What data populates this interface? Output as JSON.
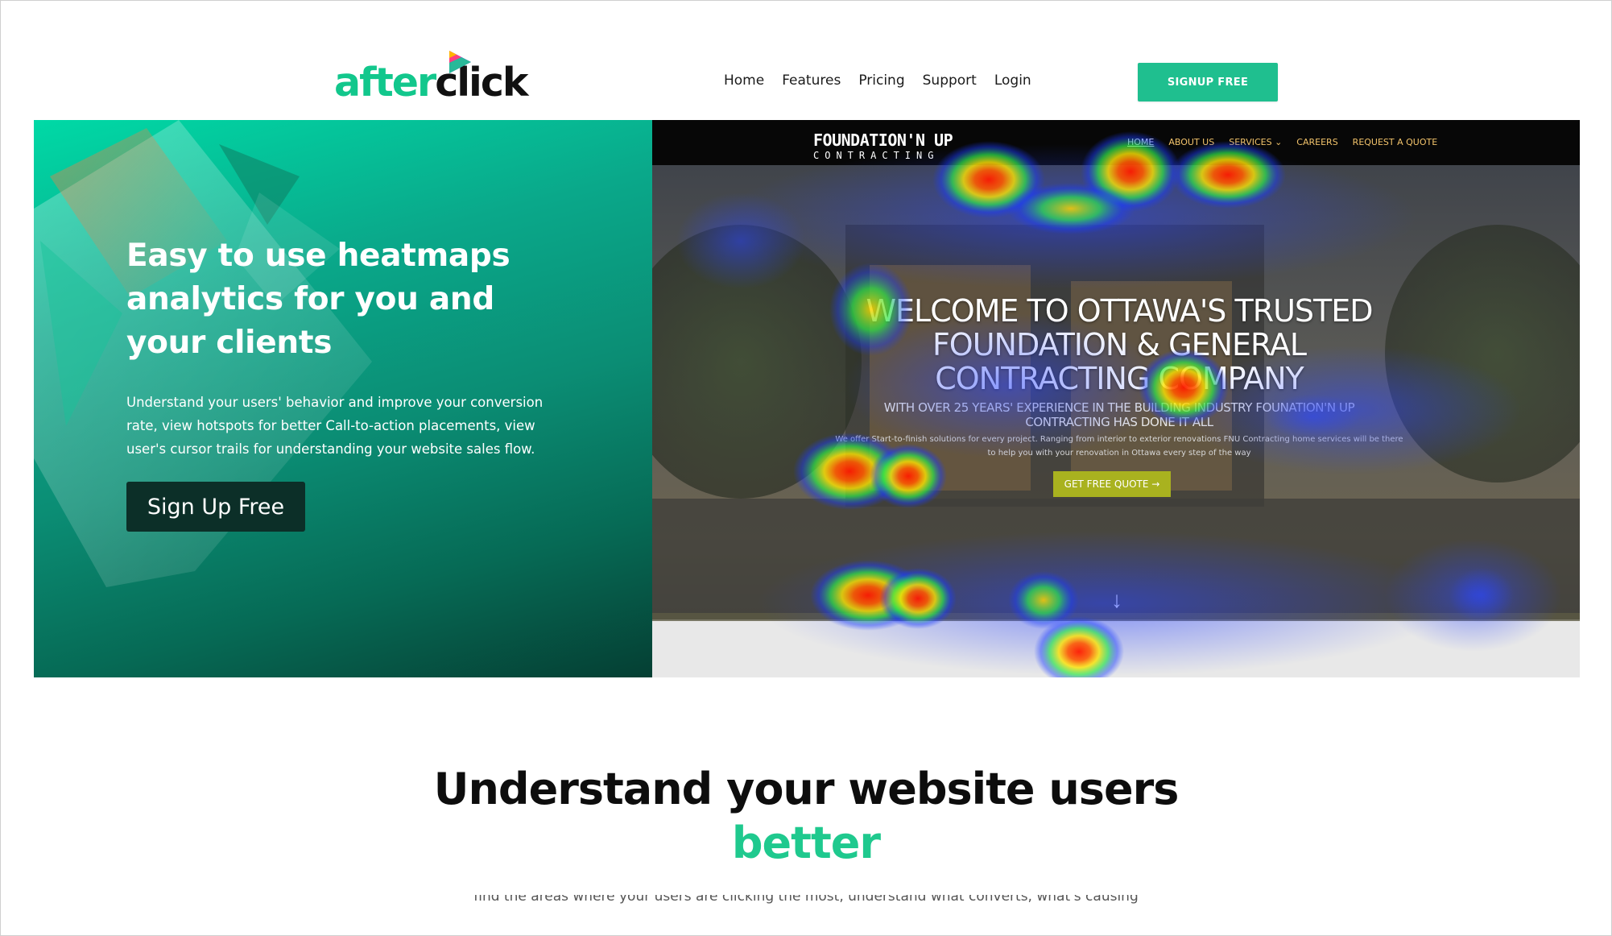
{
  "header": {
    "logo": {
      "part1": "after",
      "part2": "click"
    },
    "nav": [
      "Home",
      "Features",
      "Pricing",
      "Support",
      "Login"
    ],
    "signup_label": "SIGNUP FREE"
  },
  "hero": {
    "title": "Easy to use heatmaps analytics for you and your clients",
    "description": "Understand your users' behavior and improve your conversion rate, view hotspots for better Call-to-action placements, view user's cursor trails for understanding your website sales flow.",
    "cta_label": "Sign Up Free"
  },
  "heatmap_preview": {
    "brand": "FOUNDATION'N UP",
    "brand_sub": "CONTRACTING",
    "nav": [
      "HOME",
      "ABOUT US",
      "SERVICES ⌄",
      "CAREERS",
      "REQUEST A QUOTE"
    ],
    "headline_line1": "WELCOME TO OTTAWA'S TRUSTED",
    "headline_line2": "FOUNDATION & GENERAL",
    "headline_line3": "CONTRACTING COMPANY",
    "sub_line1": "WITH OVER 25 YEARS' EXPERIENCE IN THE BUILDING INDUSTRY FOUNATION'N UP",
    "sub_line2": "CONTRACTING HAS DONE IT ALL",
    "small_line1": "We offer Start-to-finish solutions for every project. Ranging from interior to exterior renovations FNU Contracting home services will be there",
    "small_line2": "to help you with your renovation in Ottawa every step of the way",
    "cta_label": "GET FREE QUOTE →",
    "arrow": "↓"
  },
  "section": {
    "title": "Understand your website users",
    "title_accent": "better",
    "description": "find the areas where your users are clicking the most, understand what converts, what's causing"
  },
  "colors": {
    "brand_green": "#1fbf8f",
    "accent_green": "#1fc98e",
    "dark_button": "#0c2f28"
  }
}
